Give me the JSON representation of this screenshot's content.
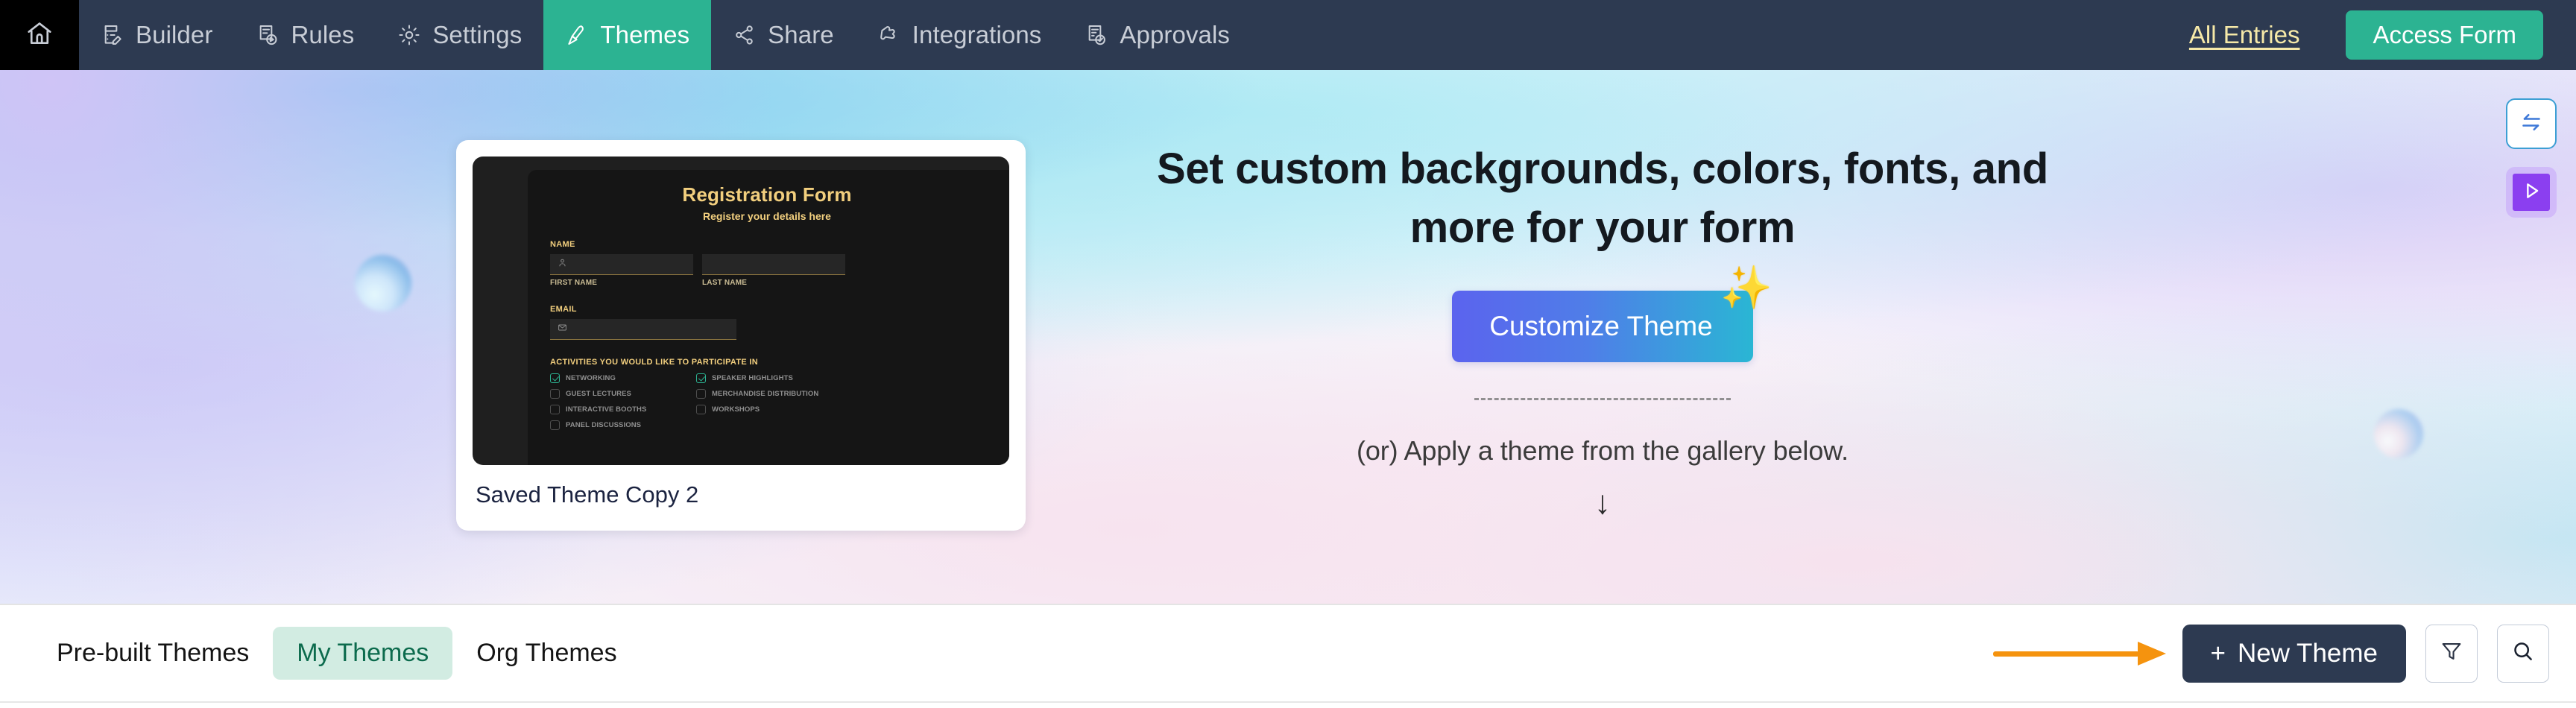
{
  "topnav": {
    "home_icon": "home-icon",
    "items": [
      {
        "label": "Builder",
        "icon": "form-builder-icon",
        "active": false
      },
      {
        "label": "Rules",
        "icon": "rules-play-icon",
        "active": false
      },
      {
        "label": "Settings",
        "icon": "gear-icon",
        "active": false
      },
      {
        "label": "Themes",
        "icon": "brush-icon",
        "active": true
      },
      {
        "label": "Share",
        "icon": "share-nodes-icon",
        "active": false
      },
      {
        "label": "Integrations",
        "icon": "puzzle-icon",
        "active": false
      },
      {
        "label": "Approvals",
        "icon": "approval-doc-icon",
        "active": false
      }
    ],
    "all_entries_label": "All Entries",
    "access_form_label": "Access Form",
    "active_bg": "#2cb392",
    "bar_bg": "#2d3a51",
    "link_color": "#f6e9a8"
  },
  "hero": {
    "title": "Set custom backgrounds, colors, fonts, and more for your form",
    "cta_label": "Customize Theme",
    "cta_sparkle": "sparkles-icon",
    "cta_gradient_from": "#5b63ee",
    "cta_gradient_to": "#2ab6d4",
    "sub_note": "(or) Apply a theme from the gallery below.",
    "down_arrow": "↓"
  },
  "theme_card": {
    "name": "Saved Theme Copy 2",
    "preview": {
      "title": "Registration Form",
      "subtitle": "Register your details here",
      "accent_color": "#f2cf7e",
      "bg_color": "#151515",
      "name_label": "NAME",
      "first_name_caption": "FIRST NAME",
      "last_name_caption": "LAST NAME",
      "email_label": "EMAIL",
      "activities_label": "ACTIVITIES YOU WOULD LIKE TO PARTICIPATE IN",
      "first_name_icon": "user-icon",
      "email_icon": "envelope-icon",
      "checkboxes": [
        {
          "label": "NETWORKING",
          "checked": true
        },
        {
          "label": "SPEAKER HIGHLIGHTS",
          "checked": true
        },
        {
          "label": "GUEST LECTURES",
          "checked": false
        },
        {
          "label": "MERCHANDISE DISTRIBUTION",
          "checked": false
        },
        {
          "label": "INTERACTIVE BOOTHS",
          "checked": false
        },
        {
          "label": "WORKSHOPS",
          "checked": false
        },
        {
          "label": "PANEL DISCUSSIONS",
          "checked": false
        }
      ]
    }
  },
  "float_buttons": [
    {
      "name": "swap-icon",
      "color": "#3d9fd4"
    },
    {
      "name": "play-icon",
      "color": "#8b3ff0"
    }
  ],
  "tabbar": {
    "tabs": [
      {
        "label": "Pre-built Themes",
        "active": false
      },
      {
        "label": "My Themes",
        "active": true
      },
      {
        "label": "Org Themes",
        "active": false
      }
    ],
    "active_tab_bg": "#d2ece2",
    "active_tab_color": "#0c6b4d",
    "new_theme_label": "New Theme",
    "new_theme_plus": "+",
    "filter_icon": "filter-icon",
    "search_icon": "search-icon",
    "annotation_arrow_color": "#f5930e"
  }
}
